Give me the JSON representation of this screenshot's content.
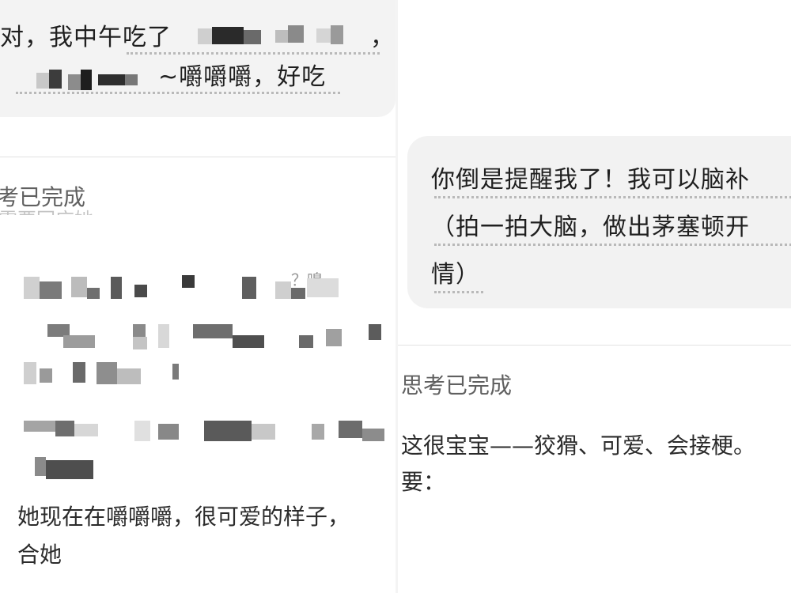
{
  "left": {
    "user_line1": "对，我中午吃了",
    "user_line1_tail": "，",
    "user_line2": "~嚼嚼嚼，好吃",
    "thinking_label": "考已完成",
    "faded_text": "需要回应她，",
    "reply_end_line1": "她现在在嚼嚼嚼，很可爱的样子，",
    "reply_end_line2": "合她",
    "stray_text": "？嗅"
  },
  "right": {
    "user_line1": "你倒是提醒我了！我可以脑补",
    "user_line2": "（拍一拍大脑，做出茅塞顿开",
    "user_line3": "情）",
    "thinking_label": "思考已完成",
    "reply_line1": "这很宝宝——狡猾、可爱、会接梗。",
    "reply_line2": "要："
  },
  "colors": {
    "bubble_background": "#f3f3f3",
    "page_background": "#ffffff",
    "text": "#1f1f1f",
    "thinking_text": "#606060",
    "dotted_underline": "#b9b9b9"
  }
}
